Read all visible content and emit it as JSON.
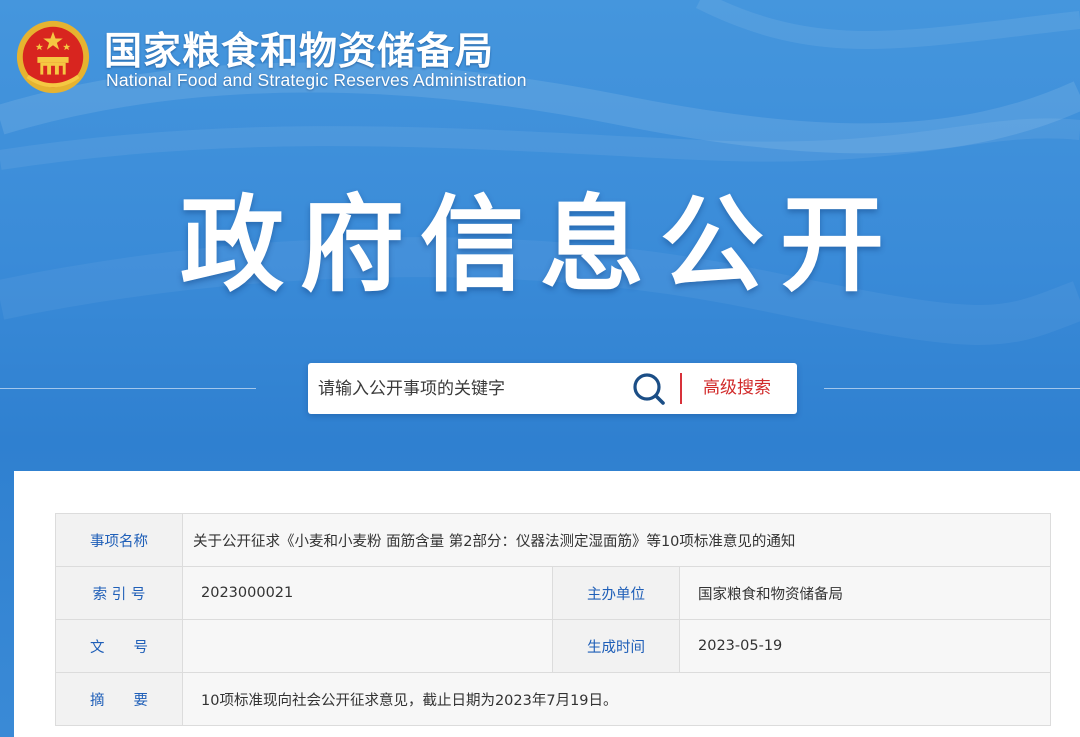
{
  "header": {
    "agency_name_cn": "国家粮食和物资储备局",
    "agency_name_en": "National Food and Strategic Reserves Administration",
    "emblem_icon": "national-emblem-icon"
  },
  "hero": {
    "title": "政府信息公开"
  },
  "search": {
    "placeholder": "请输入公开事项的关键字",
    "search_icon": "search-icon",
    "advanced_label": "高级搜索"
  },
  "colors": {
    "banner_blue": "#3a8ad6",
    "label_blue": "#1f5fb8",
    "accent_red": "#d12a2a"
  },
  "info_table": {
    "item_name_label": "事项名称",
    "item_name_value": "关于公开征求《小麦和小麦粉 面筋含量 第2部分：仪器法测定湿面筋》等10项标准意见的通知",
    "index_label": "索 引 号",
    "index_value": "2023000021",
    "issuer_label": "主办单位",
    "issuer_value": "国家粮食和物资储备局",
    "doc_no_label": "文　　号",
    "doc_no_value": "",
    "date_label": "生成时间",
    "date_value": "2023-05-19",
    "summary_label": "摘　　要",
    "summary_value": "10项标准现向社会公开征求意见，截止日期为2023年7月19日。"
  }
}
